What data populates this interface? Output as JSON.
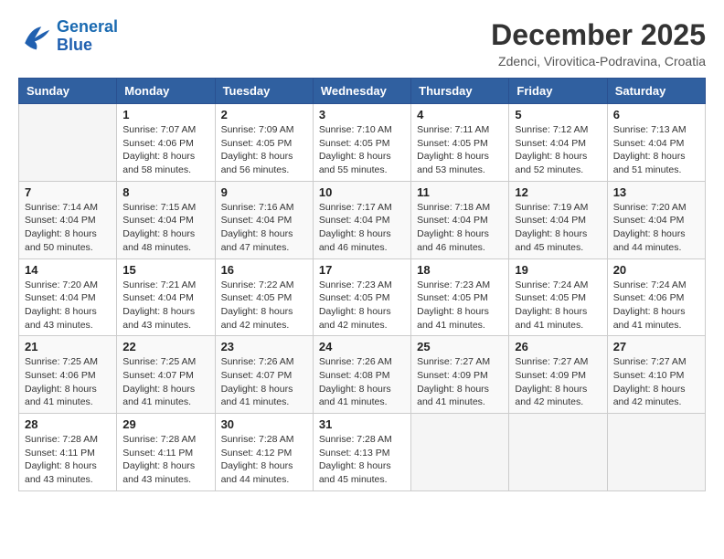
{
  "header": {
    "logo_line1": "General",
    "logo_line2": "Blue",
    "month": "December 2025",
    "location": "Zdenci, Virovitica-Podravina, Croatia"
  },
  "weekdays": [
    "Sunday",
    "Monday",
    "Tuesday",
    "Wednesday",
    "Thursday",
    "Friday",
    "Saturday"
  ],
  "weeks": [
    [
      {
        "day": "",
        "info": ""
      },
      {
        "day": "1",
        "info": "Sunrise: 7:07 AM\nSunset: 4:06 PM\nDaylight: 8 hours\nand 58 minutes."
      },
      {
        "day": "2",
        "info": "Sunrise: 7:09 AM\nSunset: 4:05 PM\nDaylight: 8 hours\nand 56 minutes."
      },
      {
        "day": "3",
        "info": "Sunrise: 7:10 AM\nSunset: 4:05 PM\nDaylight: 8 hours\nand 55 minutes."
      },
      {
        "day": "4",
        "info": "Sunrise: 7:11 AM\nSunset: 4:05 PM\nDaylight: 8 hours\nand 53 minutes."
      },
      {
        "day": "5",
        "info": "Sunrise: 7:12 AM\nSunset: 4:04 PM\nDaylight: 8 hours\nand 52 minutes."
      },
      {
        "day": "6",
        "info": "Sunrise: 7:13 AM\nSunset: 4:04 PM\nDaylight: 8 hours\nand 51 minutes."
      }
    ],
    [
      {
        "day": "7",
        "info": "Sunrise: 7:14 AM\nSunset: 4:04 PM\nDaylight: 8 hours\nand 50 minutes."
      },
      {
        "day": "8",
        "info": "Sunrise: 7:15 AM\nSunset: 4:04 PM\nDaylight: 8 hours\nand 48 minutes."
      },
      {
        "day": "9",
        "info": "Sunrise: 7:16 AM\nSunset: 4:04 PM\nDaylight: 8 hours\nand 47 minutes."
      },
      {
        "day": "10",
        "info": "Sunrise: 7:17 AM\nSunset: 4:04 PM\nDaylight: 8 hours\nand 46 minutes."
      },
      {
        "day": "11",
        "info": "Sunrise: 7:18 AM\nSunset: 4:04 PM\nDaylight: 8 hours\nand 46 minutes."
      },
      {
        "day": "12",
        "info": "Sunrise: 7:19 AM\nSunset: 4:04 PM\nDaylight: 8 hours\nand 45 minutes."
      },
      {
        "day": "13",
        "info": "Sunrise: 7:20 AM\nSunset: 4:04 PM\nDaylight: 8 hours\nand 44 minutes."
      }
    ],
    [
      {
        "day": "14",
        "info": "Sunrise: 7:20 AM\nSunset: 4:04 PM\nDaylight: 8 hours\nand 43 minutes."
      },
      {
        "day": "15",
        "info": "Sunrise: 7:21 AM\nSunset: 4:04 PM\nDaylight: 8 hours\nand 43 minutes."
      },
      {
        "day": "16",
        "info": "Sunrise: 7:22 AM\nSunset: 4:05 PM\nDaylight: 8 hours\nand 42 minutes."
      },
      {
        "day": "17",
        "info": "Sunrise: 7:23 AM\nSunset: 4:05 PM\nDaylight: 8 hours\nand 42 minutes."
      },
      {
        "day": "18",
        "info": "Sunrise: 7:23 AM\nSunset: 4:05 PM\nDaylight: 8 hours\nand 41 minutes."
      },
      {
        "day": "19",
        "info": "Sunrise: 7:24 AM\nSunset: 4:05 PM\nDaylight: 8 hours\nand 41 minutes."
      },
      {
        "day": "20",
        "info": "Sunrise: 7:24 AM\nSunset: 4:06 PM\nDaylight: 8 hours\nand 41 minutes."
      }
    ],
    [
      {
        "day": "21",
        "info": "Sunrise: 7:25 AM\nSunset: 4:06 PM\nDaylight: 8 hours\nand 41 minutes."
      },
      {
        "day": "22",
        "info": "Sunrise: 7:25 AM\nSunset: 4:07 PM\nDaylight: 8 hours\nand 41 minutes."
      },
      {
        "day": "23",
        "info": "Sunrise: 7:26 AM\nSunset: 4:07 PM\nDaylight: 8 hours\nand 41 minutes."
      },
      {
        "day": "24",
        "info": "Sunrise: 7:26 AM\nSunset: 4:08 PM\nDaylight: 8 hours\nand 41 minutes."
      },
      {
        "day": "25",
        "info": "Sunrise: 7:27 AM\nSunset: 4:09 PM\nDaylight: 8 hours\nand 41 minutes."
      },
      {
        "day": "26",
        "info": "Sunrise: 7:27 AM\nSunset: 4:09 PM\nDaylight: 8 hours\nand 42 minutes."
      },
      {
        "day": "27",
        "info": "Sunrise: 7:27 AM\nSunset: 4:10 PM\nDaylight: 8 hours\nand 42 minutes."
      }
    ],
    [
      {
        "day": "28",
        "info": "Sunrise: 7:28 AM\nSunset: 4:11 PM\nDaylight: 8 hours\nand 43 minutes."
      },
      {
        "day": "29",
        "info": "Sunrise: 7:28 AM\nSunset: 4:11 PM\nDaylight: 8 hours\nand 43 minutes."
      },
      {
        "day": "30",
        "info": "Sunrise: 7:28 AM\nSunset: 4:12 PM\nDaylight: 8 hours\nand 44 minutes."
      },
      {
        "day": "31",
        "info": "Sunrise: 7:28 AM\nSunset: 4:13 PM\nDaylight: 8 hours\nand 45 minutes."
      },
      {
        "day": "",
        "info": ""
      },
      {
        "day": "",
        "info": ""
      },
      {
        "day": "",
        "info": ""
      }
    ]
  ]
}
